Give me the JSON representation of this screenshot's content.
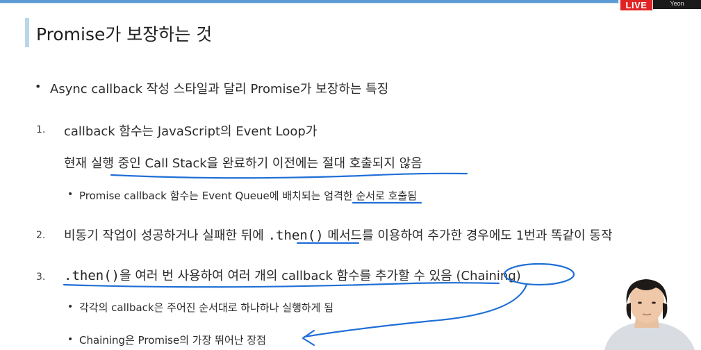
{
  "broadcast": {
    "live_label": "LIVE",
    "cam_label": "Yeon"
  },
  "slide": {
    "title": "Promise가 보장하는 것",
    "intro_bullet": "•",
    "intro": "Async callback 작성 스타일과 달리 Promise가 보장하는 특징",
    "items": [
      {
        "number": "1.",
        "line1": "callback 함수는 JavaScript의 Event Loop가",
        "line2": "현재 실행 중인 Call Stack을 완료하기 이전에는 절대 호출되지 않음",
        "sub_bullet": "•",
        "sub": "Promise callback 함수는 Event Queue에 배치되는 엄격한 순서로 호출됨"
      },
      {
        "number": "2.",
        "text_before": "비동기 작업이 성공하거나 실패한 뒤에",
        "code": ".then()",
        "text_after": "메서드를 이용하여 추가한 경우에도 1번과 똑같이 동작"
      },
      {
        "number": "3.",
        "code": ".then()",
        "text_after": "을 여러 번 사용하여 여러 개의 callback 함수를 추가할 수 있음 (Chaining)",
        "sub_bullet": "•",
        "subs": [
          "각각의 callback은 주어진 순서대로 하나하나 실행하게 됨",
          "Chaining은 Promise의 가장 뛰어난 장점"
        ]
      }
    ]
  },
  "colors": {
    "title_bar": "#b9d7ea",
    "ink": "#1f6fd6",
    "live": "#e02424"
  }
}
